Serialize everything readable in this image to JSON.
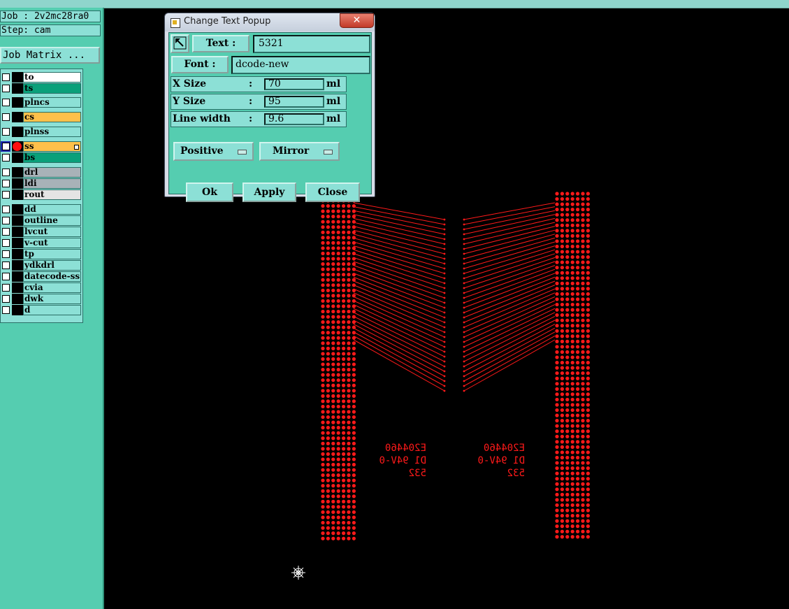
{
  "left_panel": {
    "job_label": "Job : 2v2mc28ra0",
    "step_label": "Step: cam",
    "job_matrix_label": "Job Matrix ...",
    "layers": [
      {
        "name": "to",
        "color": "#ffffff"
      },
      {
        "name": "ts",
        "color": "#0aa07a"
      },
      {
        "name": "plncs",
        "color": "#8ce0d6"
      },
      {
        "name": "cs",
        "color": "#ffc04a"
      },
      {
        "name": "plnss",
        "color": "#8ce0d6"
      },
      {
        "name": "ss",
        "color": "#ffc04a",
        "selected": true
      },
      {
        "name": "bs",
        "color": "#0aa07a"
      },
      {
        "name": "drl",
        "color": "#a8b2b8"
      },
      {
        "name": "ldi",
        "color": "#a8b2b8"
      },
      {
        "name": "rout",
        "color": "#e4e4e4"
      },
      {
        "name": "dd",
        "color": "#8ce0d6"
      },
      {
        "name": "outline",
        "color": "#8ce0d6"
      },
      {
        "name": "lvcut",
        "color": "#8ce0d6"
      },
      {
        "name": "v-cut",
        "color": "#8ce0d6"
      },
      {
        "name": "tp",
        "color": "#8ce0d6"
      },
      {
        "name": "ydkdrl",
        "color": "#8ce0d6"
      },
      {
        "name": "datecode-ss",
        "color": "#8ce0d6"
      },
      {
        "name": "cvia",
        "color": "#8ce0d6"
      },
      {
        "name": "dwk",
        "color": "#8ce0d6"
      },
      {
        "name": "d",
        "color": "#8ce0d6"
      }
    ]
  },
  "popup": {
    "title": "Change Text Popup",
    "close_x": "✕",
    "text_button": "Text :",
    "text_value": "5321",
    "font_button": "Font :",
    "font_value": "dcode-new",
    "x_size_label": "X Size",
    "x_size_value": "70",
    "y_size_label": "Y Size",
    "y_size_value": "95",
    "line_width_label": "Line width",
    "line_width_value": "9.6",
    "colon": ":",
    "unit": "ml",
    "polarity_option": "Positive",
    "mirror_option": "Mirror",
    "ok_button": "Ok",
    "apply_button": "Apply",
    "close_button": "Close"
  },
  "canvas": {
    "trace_color": "#ff1a1a",
    "marking_left": {
      "line1": "E204460",
      "line2": "D1 94V-0",
      "line3": "532"
    },
    "marking_right": {
      "line1": "E204460",
      "line2": "D1 94V-0",
      "line3": "532"
    }
  }
}
